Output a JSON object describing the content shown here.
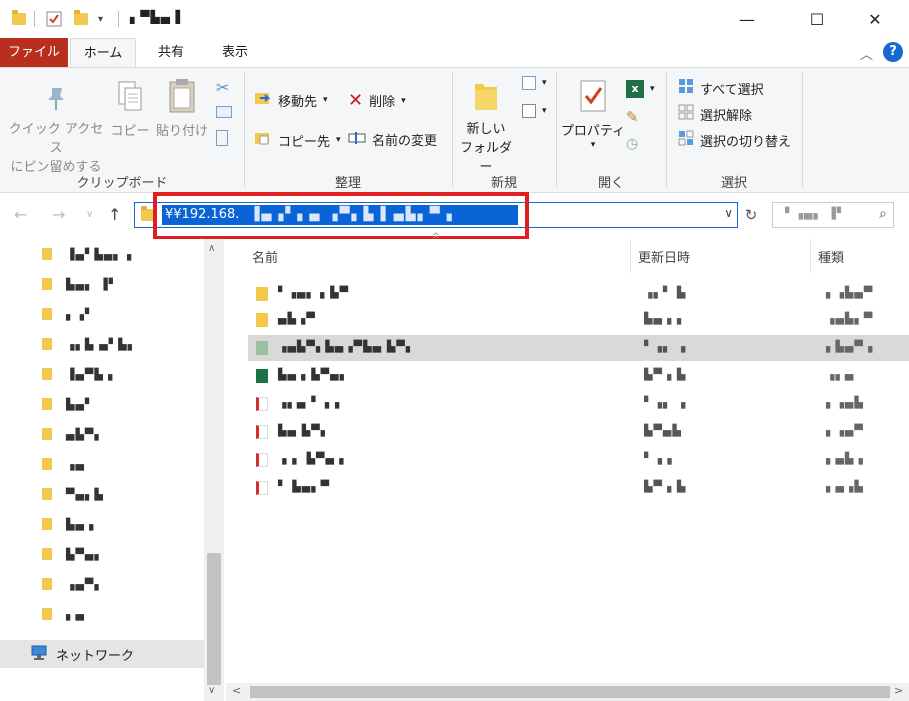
{
  "window": {
    "title": "▖▀▙▄▐",
    "minimize": "—",
    "maximize": "☐",
    "close": "✕"
  },
  "tabs": {
    "file": "ファイル",
    "home": "ホーム",
    "share": "共有",
    "view": "表示"
  },
  "ribbon": {
    "clipboard": {
      "label": "クリップボード",
      "pin_line1": "クイック アクセス",
      "pin_line2": "にピン留めする",
      "copy": "コピー",
      "paste": "貼り付け"
    },
    "organize": {
      "label": "整理",
      "move_to": "移動先",
      "copy_to": "コピー先",
      "delete": "削除",
      "rename": "名前の変更"
    },
    "new": {
      "label": "新規",
      "new_folder_line1": "新しい",
      "new_folder_line2": "フォルダー"
    },
    "open": {
      "label": "開く",
      "properties": "プロパティ"
    },
    "select": {
      "label": "選択",
      "select_all": "すべて選択",
      "select_none": "選択解除",
      "invert": "選択の切り替え"
    }
  },
  "address": {
    "path_visible": "¥¥192.168.",
    "path_obscured": "▐▄▗▘▖▄ ▗▀▖▙▐ ▄▙▖▀▗"
  },
  "search": {
    "placeholder": "▘▗▄▖ ▐▘"
  },
  "columns": {
    "name": "名前",
    "date": "更新日時",
    "type": "種類"
  },
  "nav_pane": {
    "items": [
      "▐▄▘▙▄▖▗",
      "▙▄▖ ▐▘",
      "▖▗▘",
      "▗▖▙ ▄▘▙▖",
      "▐▄▀▙▗",
      "▙▄▘",
      "▄▙▀▖",
      "▗▄",
      "▀▄▖▙",
      "▙▄▗",
      "▙▀▄▖",
      "▗▄▀▖",
      "▖▄"
    ],
    "network": "ネットワーク"
  },
  "files": [
    {
      "name": "▘▗▄▖▗ ▙▀",
      "date": "▗▖▘ ▙",
      "type": "▖▗▙▄▀",
      "kind": "folder"
    },
    {
      "name": "▄▙▗▀",
      "date": "▙▄▗ ▖",
      "type": "▗▄▙▖▀",
      "kind": "folder"
    },
    {
      "name": "▗▄▙▀▖▙▄▗▀▙▄ ▙▀▖",
      "date": "▘▗▖ ▗",
      "type": "▖▙▄▀▗",
      "kind": "doc"
    },
    {
      "name": "▙▄▗ ▙▀▄▖",
      "date": "▙▀▗ ▙",
      "type": "▗▖▄",
      "kind": "xls"
    },
    {
      "name": "▗▖▄ ▘▗ ▖",
      "date": "▘▗▖ ▗",
      "type": "▖▗▄▙",
      "kind": "pdf"
    },
    {
      "name": "▙▄ ▙▀▖",
      "date": "▙▀▄▙",
      "type": "▖▗▄▀",
      "kind": "pdf"
    },
    {
      "name": "▗ ▖ ▙▀▄▗",
      "date": "▘▗ ▖",
      "type": "▖▄▙▗",
      "kind": "pdf"
    },
    {
      "name": "▘ ▙▄▖▀",
      "date": "▙▀▗ ▙",
      "type": "▖▄▗▙",
      "kind": "pdf"
    }
  ],
  "colors": {
    "file_tab": "#b92e1c",
    "selection": "#0a64d6",
    "highlight_box": "#e02020",
    "help": "#1769d1"
  }
}
